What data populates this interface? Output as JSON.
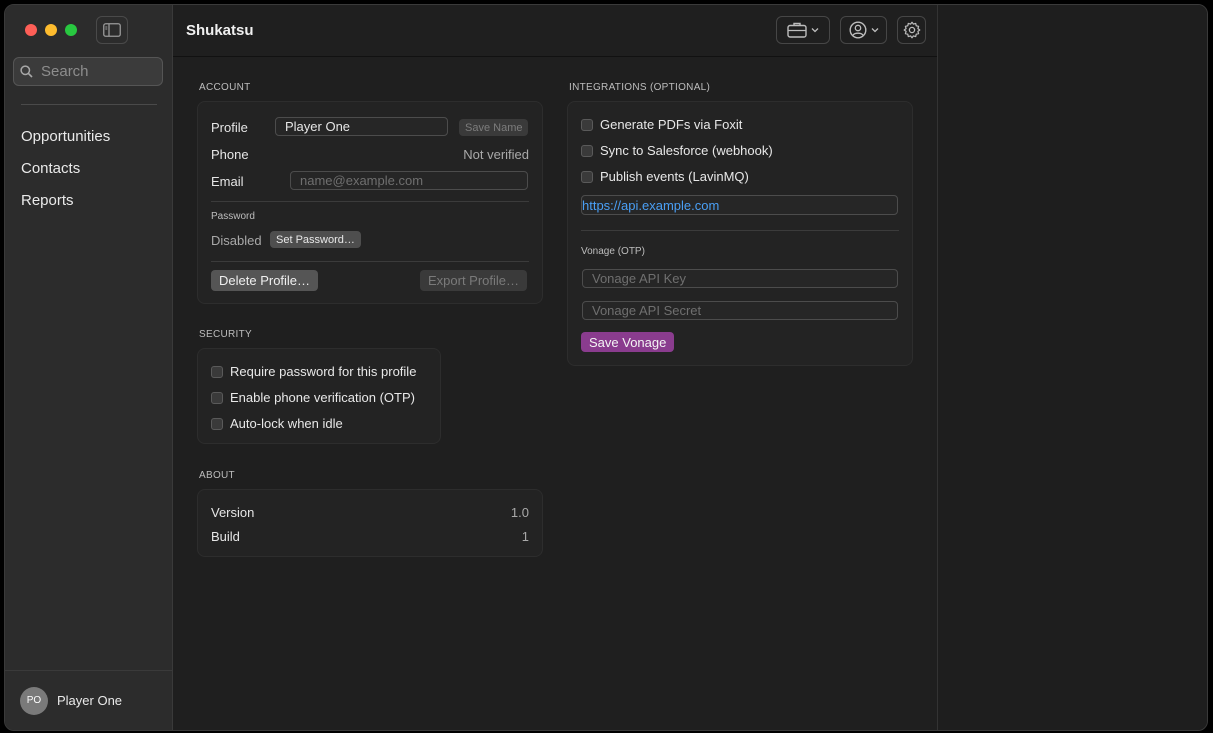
{
  "app": {
    "title": "Shukatsu"
  },
  "sidebar": {
    "search_placeholder": "Search",
    "items": [
      {
        "label": "Opportunities"
      },
      {
        "label": "Contacts"
      },
      {
        "label": "Reports"
      }
    ],
    "user": {
      "initials": "PO",
      "name": "Player One"
    }
  },
  "account": {
    "section_title": "ACCOUNT",
    "profile_label": "Profile",
    "profile_value": "Player One",
    "save_name_label": "Save Name",
    "phone_label": "Phone",
    "phone_status": "Not verified",
    "email_label": "Email",
    "email_placeholder": "name@example.com",
    "password_label": "Password",
    "password_status": "Disabled",
    "set_password_label": "Set Password…",
    "delete_profile_label": "Delete Profile…",
    "export_profile_label": "Export Profile…"
  },
  "security": {
    "section_title": "SECURITY",
    "options": [
      {
        "label": "Require password for this profile",
        "checked": false
      },
      {
        "label": "Enable phone verification (OTP)",
        "checked": false
      },
      {
        "label": "Auto-lock when idle",
        "checked": false
      }
    ]
  },
  "about": {
    "section_title": "ABOUT",
    "version_label": "Version",
    "version_value": "1.0",
    "build_label": "Build",
    "build_value": "1"
  },
  "integrations": {
    "section_title": "INTEGRATIONS (OPTIONAL)",
    "options": [
      {
        "label": "Generate PDFs via Foxit",
        "checked": false
      },
      {
        "label": "Sync to Salesforce (webhook)",
        "checked": false
      },
      {
        "label": "Publish events (LavinMQ)",
        "checked": false
      }
    ],
    "url_value": "https://api.example.com",
    "vonage_title": "Vonage (OTP)",
    "api_key_placeholder": "Vonage API Key",
    "api_secret_placeholder": "Vonage API Secret",
    "save_vonage_label": "Save Vonage"
  },
  "colors": {
    "accent_purple": "#8a3c8e",
    "link_blue": "#4a9ff5"
  }
}
